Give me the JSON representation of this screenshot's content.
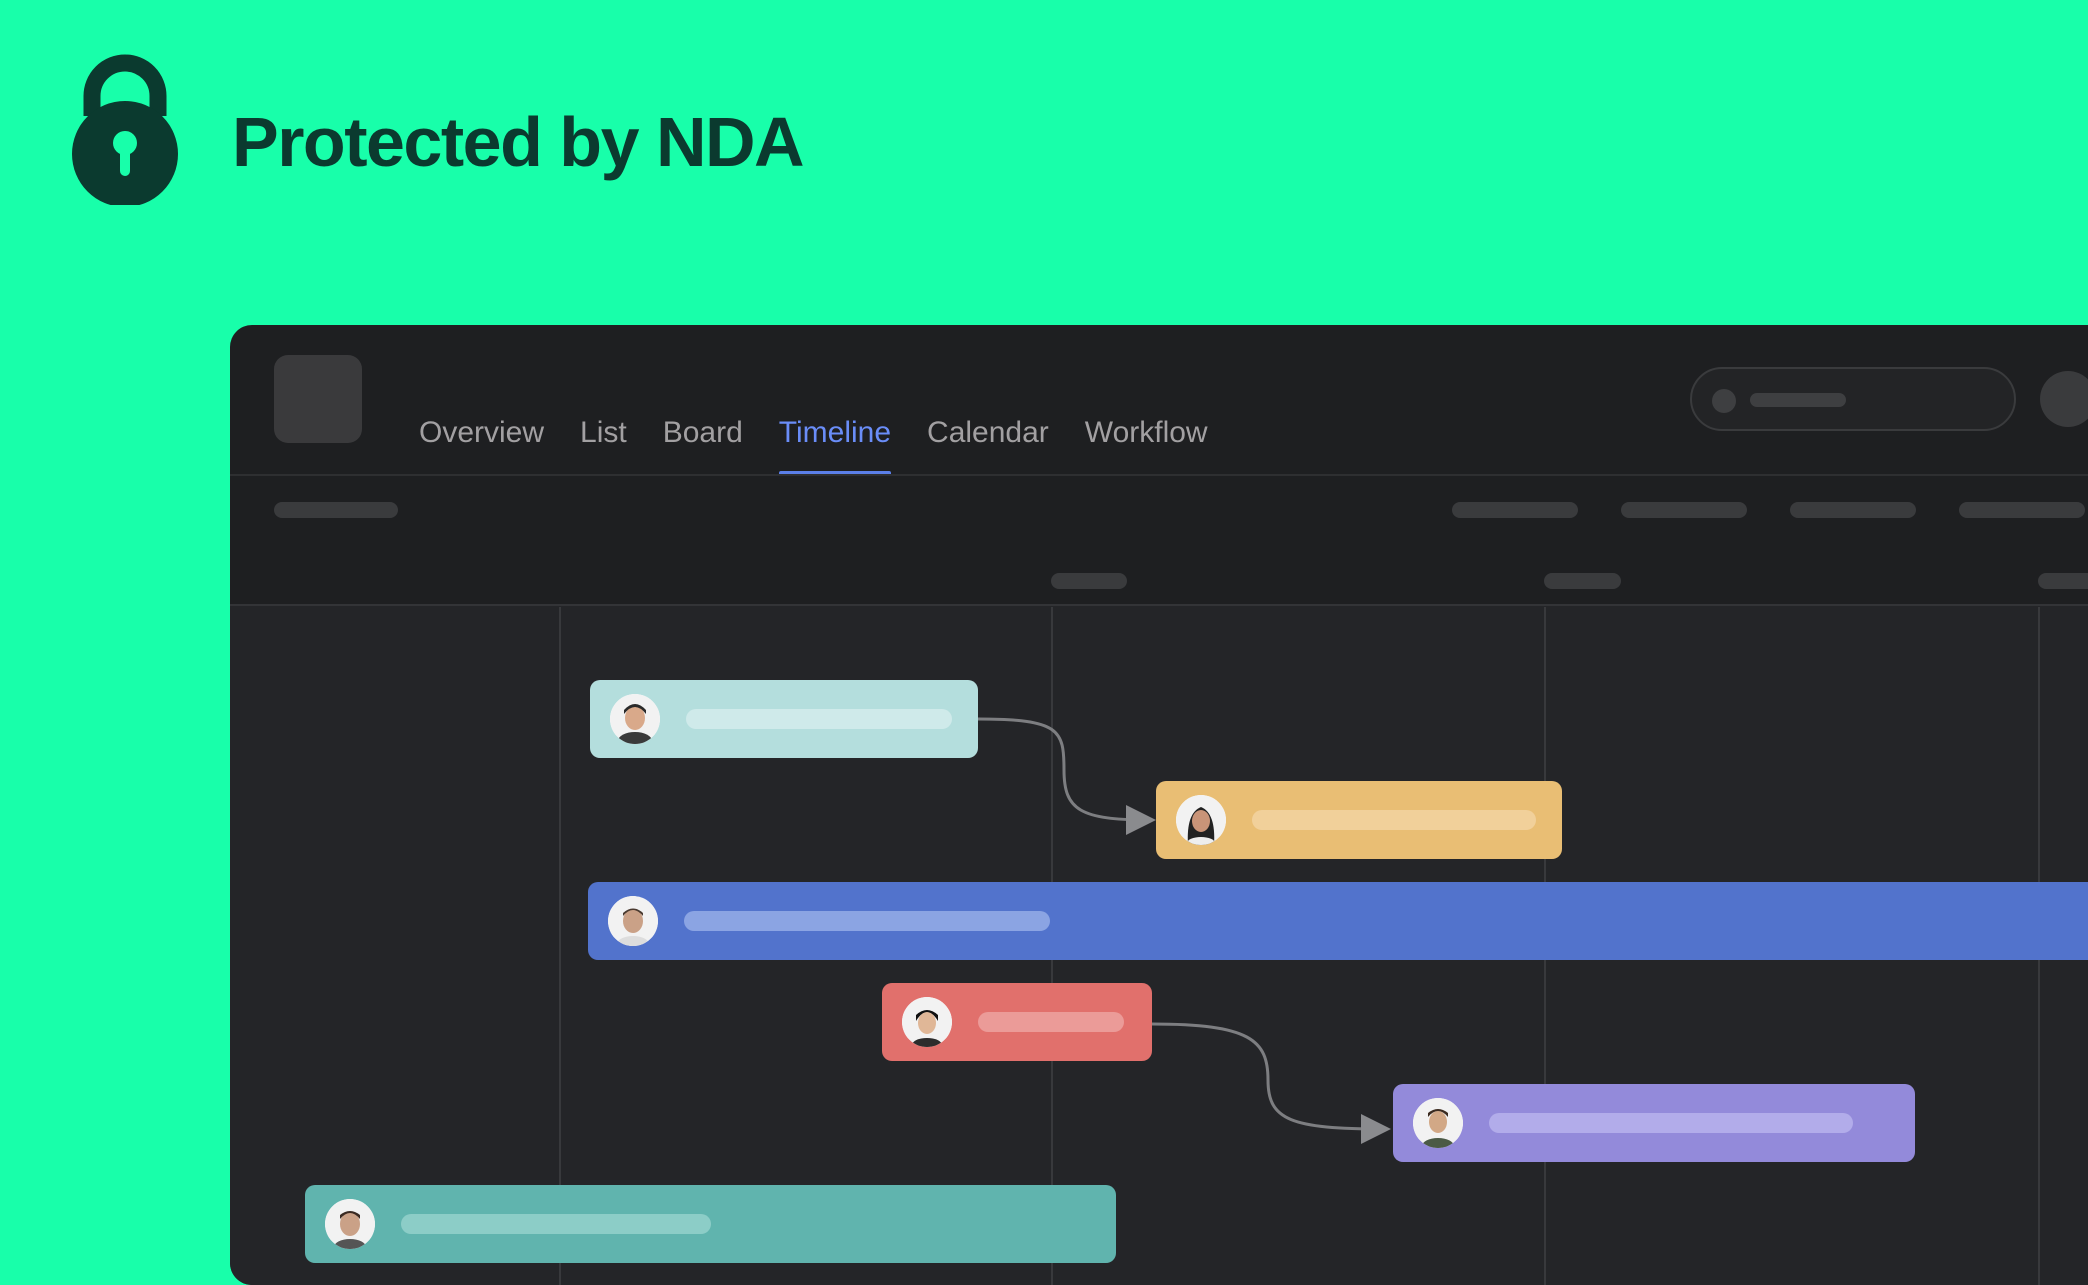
{
  "hero": {
    "title": "Protected by NDA",
    "icon": "lock-icon"
  },
  "app": {
    "tabs": [
      {
        "label": "Overview",
        "active": false
      },
      {
        "label": "List",
        "active": false
      },
      {
        "label": "Board",
        "active": false
      },
      {
        "label": "Timeline",
        "active": true
      },
      {
        "label": "Calendar",
        "active": false
      },
      {
        "label": "Workflow",
        "active": false
      }
    ]
  },
  "colors": {
    "background": "#18FFAA",
    "window": "#1e1f21",
    "accent": "#5b7fe9",
    "bar_mint": "#b4dedd",
    "bar_yellow": "#e9be74",
    "bar_blue": "#5273cc",
    "bar_red": "#e1706c",
    "bar_purple": "#938ada",
    "bar_teal": "#60b4ae"
  },
  "timeline_bars": [
    {
      "color": "#b4dedd",
      "avatar": "avatar-man-dark-hair"
    },
    {
      "color": "#e9be74",
      "avatar": "avatar-woman-long-hair"
    },
    {
      "color": "#5273cc",
      "avatar": "avatar-man-smiling"
    },
    {
      "color": "#e1706c",
      "avatar": "avatar-woman-short-hair"
    },
    {
      "color": "#938ada",
      "avatar": "avatar-man-patterned-shirt"
    },
    {
      "color": "#60b4ae",
      "avatar": "avatar-man"
    }
  ]
}
